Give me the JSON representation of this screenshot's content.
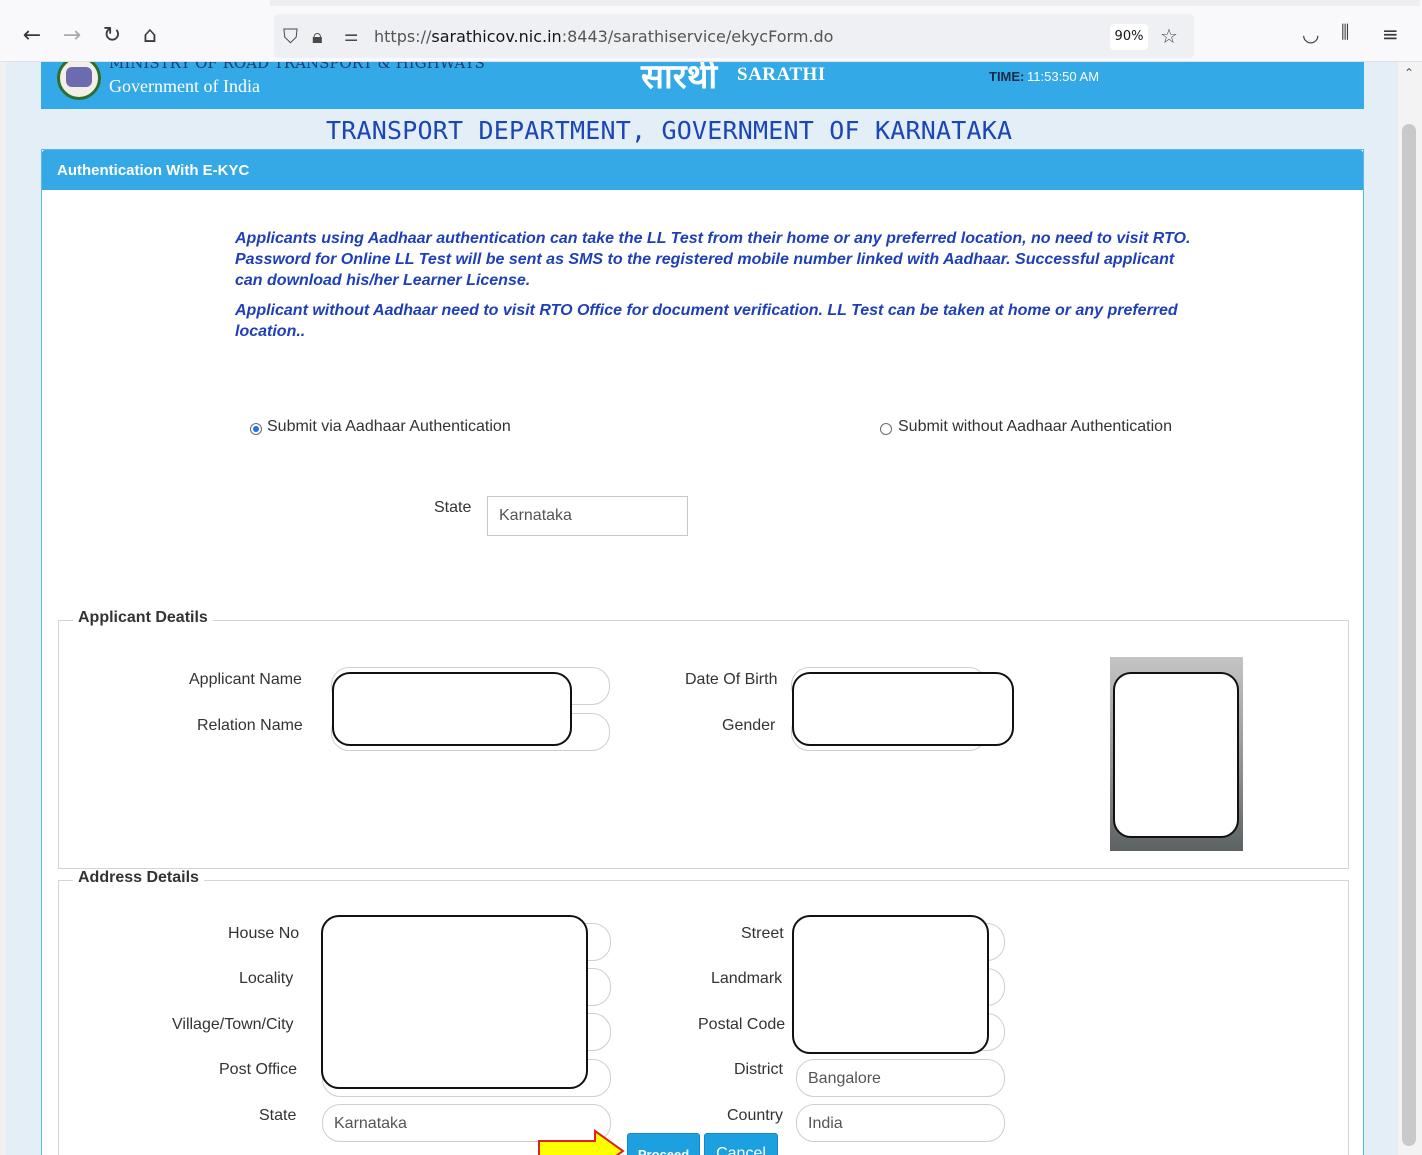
{
  "browser": {
    "url_prefix": "https://",
    "url_host": "sarathicov.nic.in",
    "url_path": ":8443/sarathiservice/ekycForm.do",
    "zoom": "90%",
    "icons": [
      "back-icon",
      "forward-icon",
      "reload-icon",
      "home-icon",
      "shield-icon",
      "lock-icon",
      "permissions-icon",
      "bookmark-star-icon",
      "pocket-icon",
      "library-icon",
      "menu-icon"
    ]
  },
  "header": {
    "ministry_partial": "MINISTRY OF ROAD TRANSPORT & HIGHWAYS",
    "gov_india": "Government of India",
    "logo_script": "सारथी",
    "sarathi": "SARATHI",
    "time_label": "TIME:",
    "time_value": "11:53:50 AM",
    "dept_title": "TRANSPORT DEPARTMENT, GOVERNMENT OF KARNATAKA"
  },
  "panel": {
    "title": "Authentication With E-KYC",
    "info_1": "Applicants using Aadhaar authentication can take the LL Test from their home or any preferred location, no need to visit RTO. Password for Online LL Test will be sent as SMS to the registered mobile number linked with Aadhaar. Successful applicant can download his/her Learner License.",
    "info_2": "Applicant without Aadhaar need to visit RTO Office for document verification. LL Test can be taken at home or any preferred location..",
    "radio_aadhaar": "Submit via Aadhaar Authentication",
    "radio_aadhaar_selected": true,
    "radio_no_aadhaar": "Submit without Aadhaar Authentication",
    "state_label": "State",
    "state_value": "Karnataka"
  },
  "applicant": {
    "legend": "Applicant Deatils",
    "name_label": "Applicant Name",
    "relation_label": "Relation Name",
    "dob_label": "Date Of Birth",
    "gender_label": "Gender"
  },
  "address": {
    "legend": "Address Details",
    "house_label": "House No",
    "locality_label": "Locality",
    "village_label": "Village/Town/City",
    "post_office_label": "Post Office",
    "state_label": "State",
    "state_value": "Karnataka",
    "street_label": "Street",
    "landmark_label": "Landmark",
    "postal_label": "Postal Code",
    "district_label": "District",
    "district_value": "Bangalore",
    "country_label": "Country",
    "country_value": "India"
  },
  "actions": {
    "proceed": "Proceed",
    "cancel": "Cancel",
    "arrow_color": "#ffff00"
  }
}
